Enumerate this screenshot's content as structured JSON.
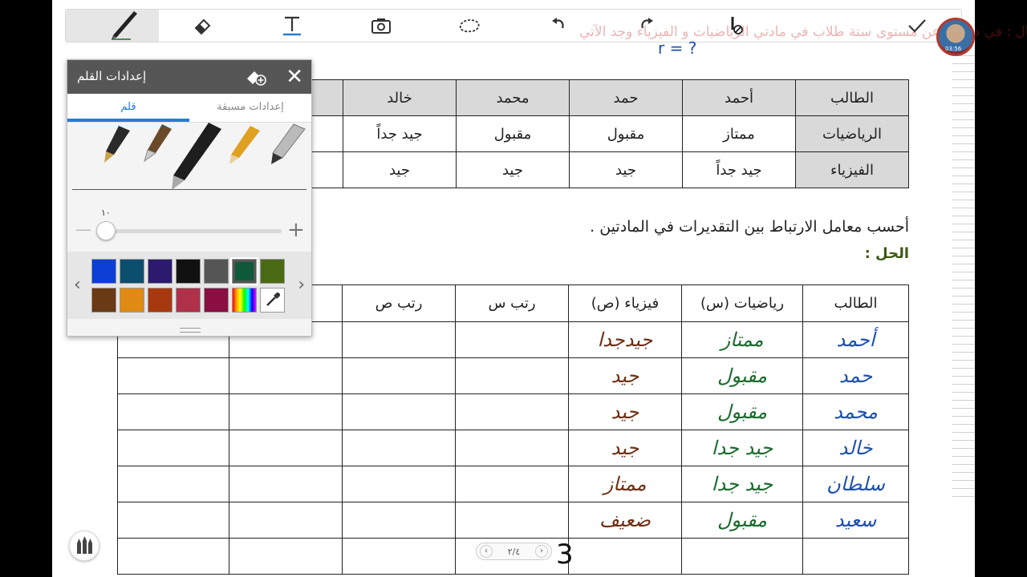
{
  "toolbar": {
    "tools": [
      "pen-icon",
      "eraser-icon",
      "text-icon",
      "screen-capture-icon",
      "lasso-icon",
      "undo-icon",
      "redo-icon",
      "pointer-icon",
      "check-icon"
    ],
    "faint_text": "مثال : في دراسة عن مستوى ستة طلاب في مادتي الرياضيات و الفيزياء وجد الآتي"
  },
  "avatar": {
    "time": "03:56"
  },
  "equation": "r = ?",
  "table1": {
    "header": [
      "الطالب",
      "أحمد",
      "حمد",
      "محمد",
      "خالد"
    ],
    "rows": [
      [
        "الرياضيات",
        "ممتاز",
        "مقبول",
        "مقبول",
        "جيد جداً"
      ],
      [
        "الفيزياء",
        "جيد جداً",
        "جيد",
        "جيد",
        "جيد"
      ]
    ]
  },
  "question": "أحسب معامل الارتباط بين التقديرات في المادتين .",
  "solution_label": "الحل :",
  "table2": {
    "header": [
      "الطالب",
      "رياضيات (س)",
      "فيزياء (ص)",
      "رتب س",
      "رتب ص",
      "",
      ""
    ],
    "rows": [
      [
        "أحمد",
        "ممتاز",
        "جيدجدا",
        "",
        "",
        "",
        ""
      ],
      [
        "حمد",
        "مقبول",
        "جيد",
        "",
        "",
        "",
        ""
      ],
      [
        "محمد",
        "مقبول",
        "جيد",
        "",
        "",
        "",
        ""
      ],
      [
        "خالد",
        "جيد جدا",
        "جيد",
        "",
        "",
        "",
        ""
      ],
      [
        "سلطان",
        "جيد جدا",
        "ممتاز",
        "",
        "",
        "",
        ""
      ],
      [
        "سعيد",
        "مقبول",
        "ضعيف",
        "",
        "",
        "",
        ""
      ],
      [
        "",
        "",
        "",
        "",
        "",
        "",
        ""
      ]
    ]
  },
  "pen_panel": {
    "title": "إعدادات القلم",
    "tabs": [
      "قلم",
      "إعدادات مسبقة"
    ],
    "active_tab": "قلم",
    "size_label": "١٠",
    "size_value": 10,
    "colors_row1": [
      "#0b3fd6",
      "#0b4e6e",
      "#2b1a6e",
      "#111111",
      "#555555",
      "#0e5a3a",
      "#4a6a14"
    ],
    "colors_row2": [
      "#6a3a14",
      "#e08a14",
      "#a8380e",
      "#b0304a",
      "#8a0e40",
      "rainbow",
      "eyedropper-icon"
    ],
    "selected_color": "#0e5a3a"
  },
  "pager": {
    "label": "٢/٤"
  },
  "page_number_handwritten": "3"
}
